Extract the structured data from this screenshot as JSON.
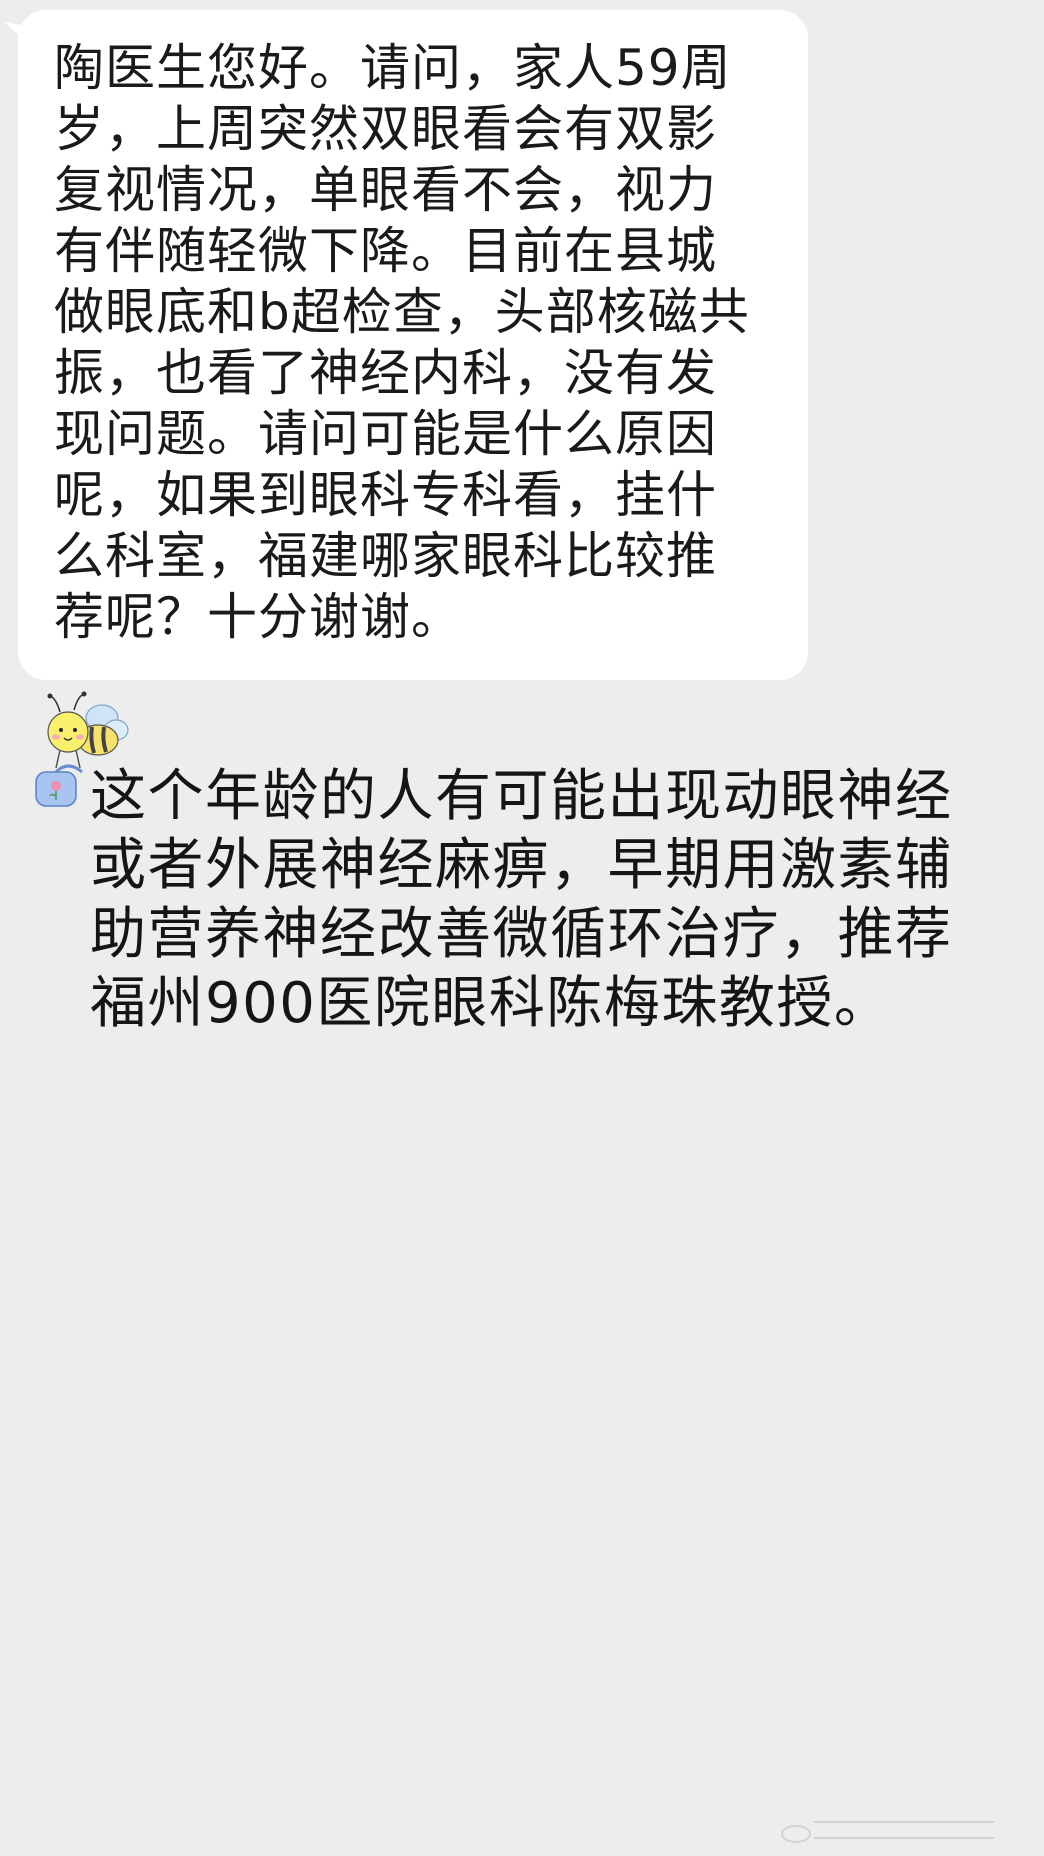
{
  "incoming_message": {
    "lines": [
      "陶医生您好。请问，家人59周",
      "岁，上周突然双眼看会有双影",
      "复视情况，单眼看不会，视力",
      "有伴随轻微下降。目前在县城",
      "做眼底和b超检查，头部核磁共",
      "振，也看了神经内科，没有发",
      "现问题。请问可能是什么原因",
      "呢，如果到眼科专科看，挂什",
      "么科室，福建哪家眼科比较推",
      "荐呢？十分谢谢。"
    ]
  },
  "reply_message": {
    "avatar_icon": "bee-sticker-icon",
    "lines": [
      "这个年龄的人有可能出现动眼神经",
      "或者外展神经麻痹，早期用激素辅",
      "助营养神经改善微循环治疗，推荐",
      "福州900医院眼科陈梅珠教授。"
    ]
  },
  "colors": {
    "background": "#ededed",
    "incoming_bubble": "#ffffff",
    "text": "#1a1a1a"
  }
}
